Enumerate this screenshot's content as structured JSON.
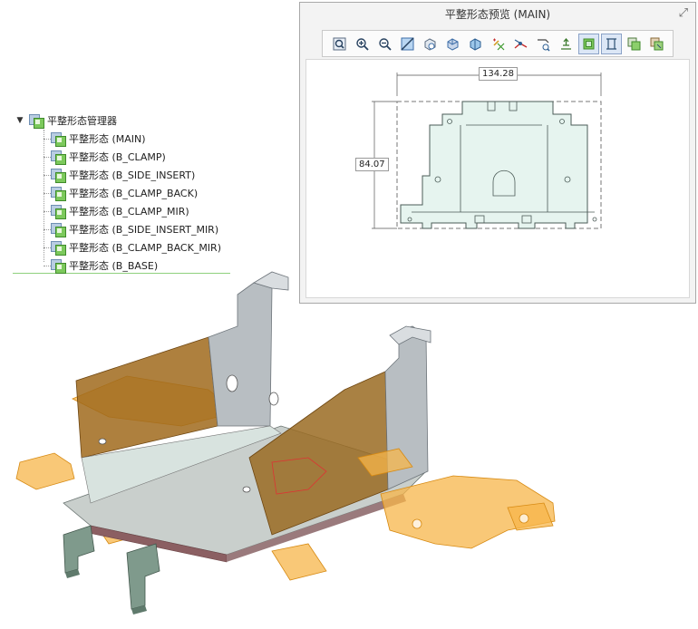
{
  "tree": {
    "root_label": "平整形态管理器",
    "items": [
      {
        "label": "平整形态 (MAIN)"
      },
      {
        "label": "平整形态 (B_CLAMP)"
      },
      {
        "label": "平整形态 (B_SIDE_INSERT)"
      },
      {
        "label": "平整形态 (B_CLAMP_BACK)"
      },
      {
        "label": "平整形态 (B_CLAMP_MIR)"
      },
      {
        "label": "平整形态 (B_SIDE_INSERT_MIR)"
      },
      {
        "label": "平整形态 (B_CLAMP_BACK_MIR)"
      },
      {
        "label": "平整形态 (B_BASE)"
      }
    ]
  },
  "dialog": {
    "title": "平整形态预览 (MAIN)",
    "toolbar_icons": [
      "refit-icon",
      "zoom-in-icon",
      "zoom-out-icon",
      "orient-icon",
      "view-manager-icon",
      "saved-views-icon",
      "display-style-icon",
      "datum-display-icon",
      "sketch-icon",
      "measure-icon",
      "dimension-icon",
      "flat-display-icon",
      "flat-outline-icon",
      "copy-view-icon",
      "export-icon"
    ],
    "active_icons": [
      "flat-display-icon",
      "flat-outline-icon"
    ],
    "dim_width": "134.28",
    "dim_height": "84.07"
  },
  "colors": {
    "accent_green": "#8fd07e",
    "part_orange": "#f5a623",
    "part_gray": "#a8b0b6",
    "part_teal": "#7f9a8c",
    "preview_fill": "#e6f4ef"
  }
}
